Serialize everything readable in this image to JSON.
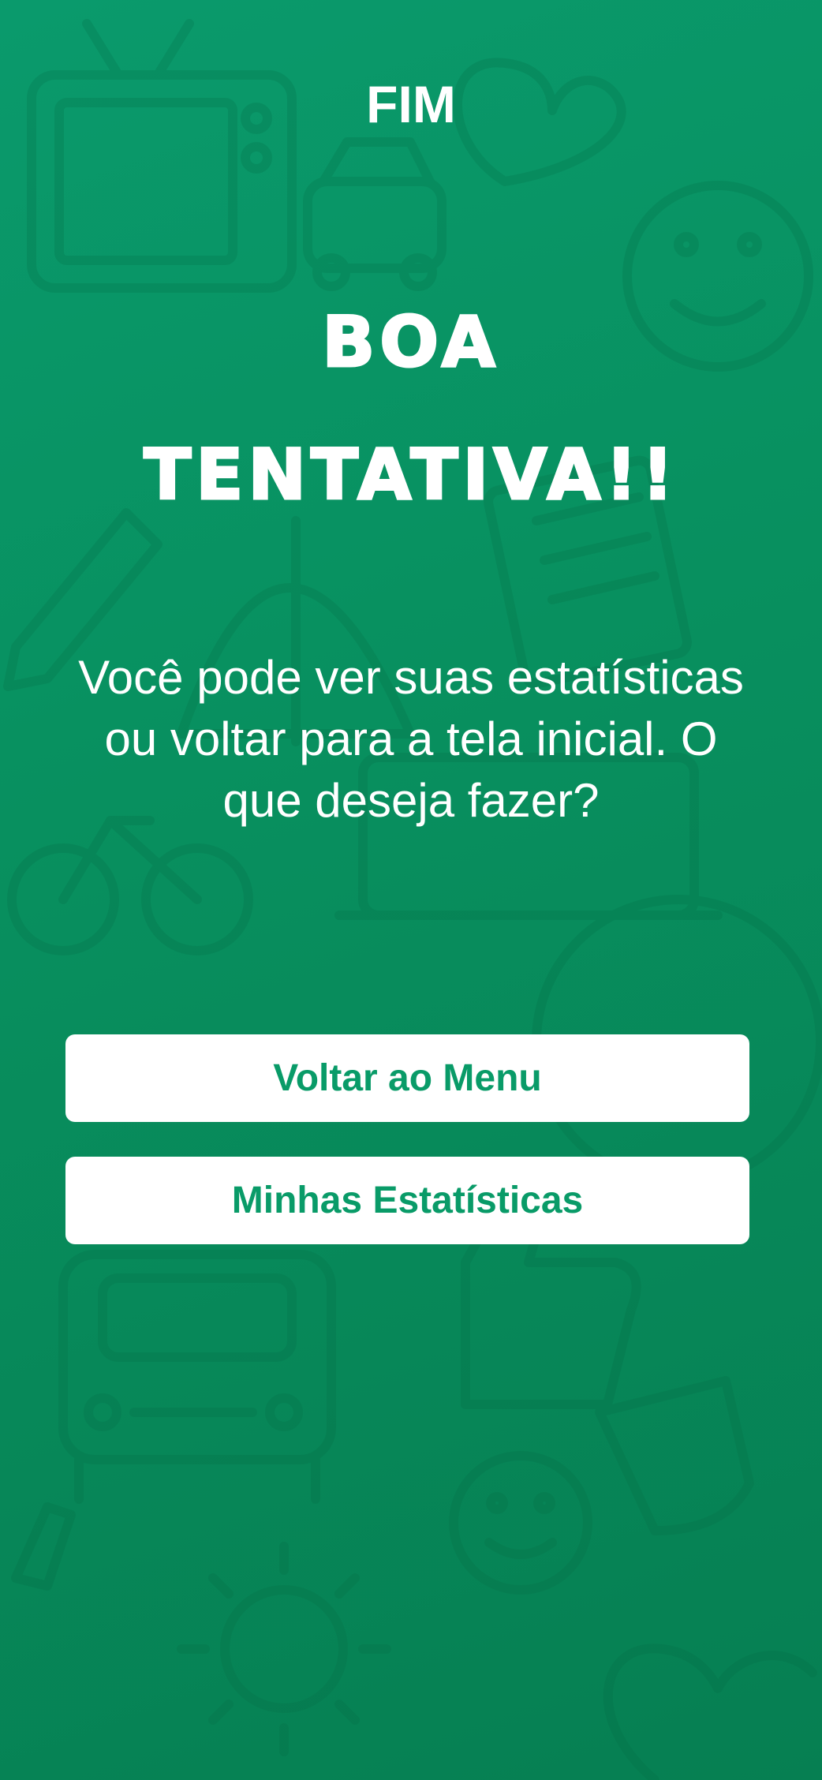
{
  "header": {
    "title": "FIM"
  },
  "result": {
    "headline_line1": "BOA",
    "headline_line2": "TENTATIVA!!",
    "message": "Você pode ver suas estatísticas ou voltar para a tela inicial. O que deseja fazer?"
  },
  "actions": {
    "menu_label": "Voltar ao Menu",
    "stats_label": "Minhas Estatísticas"
  },
  "colors": {
    "background": "#08905f",
    "button_background": "#ffffff",
    "button_text": "#099b68",
    "text": "#ffffff"
  },
  "decorations": {
    "background_icons": [
      "tv-icon",
      "heart-icon",
      "smiley-icon",
      "car-icon",
      "pencil-icon",
      "bicycle-icon",
      "document-icon",
      "thumbs-up-icon",
      "sun-icon",
      "umbrella-icon"
    ]
  }
}
